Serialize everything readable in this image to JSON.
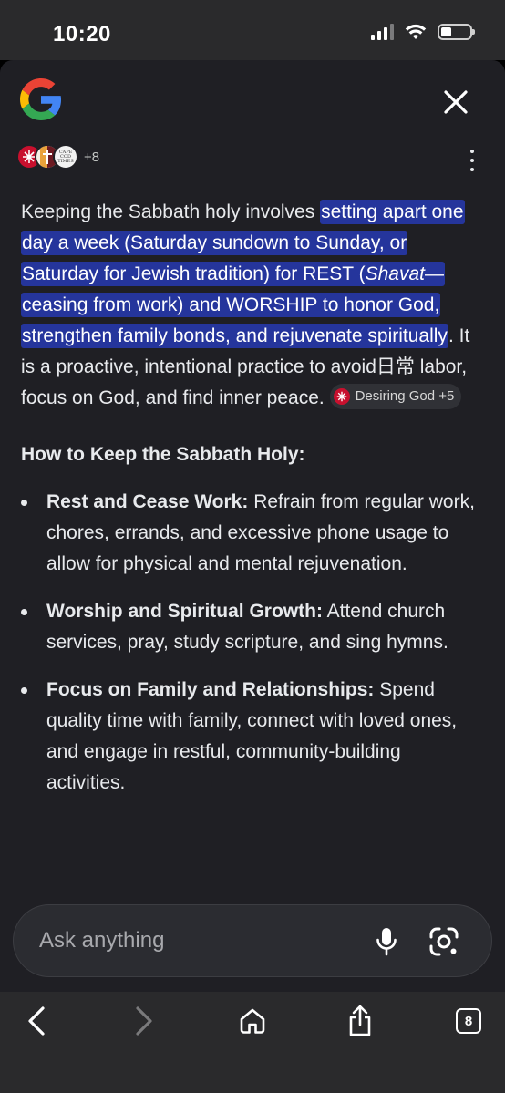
{
  "status": {
    "time": "10:20",
    "battery_level": 0.35
  },
  "sheet": {
    "close_icon": "close-icon",
    "sources_more": "+8",
    "source_logo_text": "CAPE COD TIMES"
  },
  "answer": {
    "intro_plain": "Keeping the Sabbath holy involves ",
    "highlight_1": "setting apart one day a week (Saturday sundown to Sunday, or Saturday for Jewish tradition) for REST (",
    "highlight_italic": "Shavat",
    "highlight_2": "—ceasing from work) and WORSHIP to honor God, strengthen family bonds, and rejuvenate spiritually",
    "after_highlight": ". It is a proactive, intentional practice to avoid日常 labor, focus on God, and find inner peace. ",
    "citation_chip": "Desiring God +5",
    "heading": "How to Keep the Sabbath Holy:",
    "bullets": [
      {
        "title": "Rest and Cease Work:",
        "text": " Refrain from regular work, chores, errands, and excessive phone usage to allow for physical and mental rejuvenation."
      },
      {
        "title": "Worship and Spiritual Growth:",
        "text": " Attend church services, pray, study scripture, and sing hymns."
      },
      {
        "title": "Focus on Family and Relationships:",
        "text": " Spend quality time with family, connect with loved ones, and engage in restful, community-building activities."
      }
    ]
  },
  "ask": {
    "placeholder": "Ask anything"
  },
  "toolbar": {
    "tabs_count": "8"
  },
  "colors": {
    "highlight": "#25359c",
    "sheet_bg": "#1f1f24",
    "bar_bg": "#2a2a2c"
  }
}
